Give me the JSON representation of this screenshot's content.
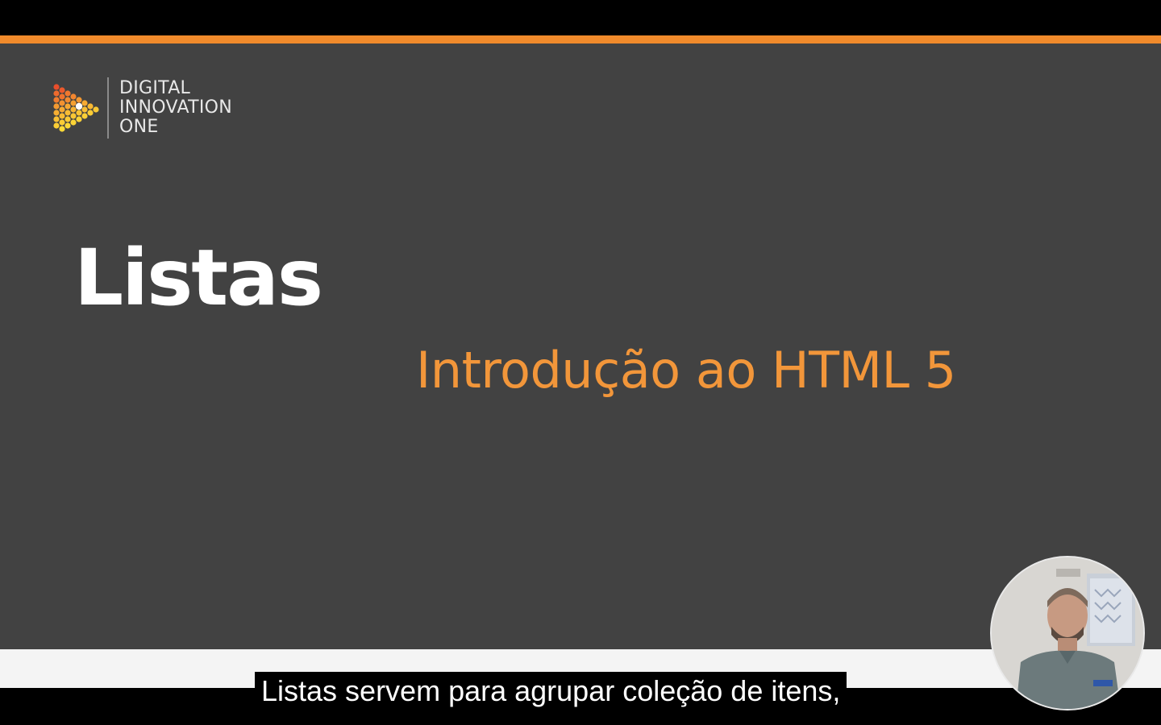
{
  "colors": {
    "accent_orange": "#f08a2b",
    "subtitle_orange": "#f2963a",
    "slide_background": "#424242",
    "title_white": "#ffffff"
  },
  "logo": {
    "icon": "play-triangle-dots-icon",
    "line1": "DIGITAL",
    "line2": "INNOVATION",
    "line3": "ONE"
  },
  "slide": {
    "title": "Listas",
    "subtitle": "Introdução ao HTML 5"
  },
  "caption": {
    "text": "Listas servem para agrupar coleção de itens,"
  },
  "presenter": {
    "icon": "presenter-webcam-icon"
  }
}
